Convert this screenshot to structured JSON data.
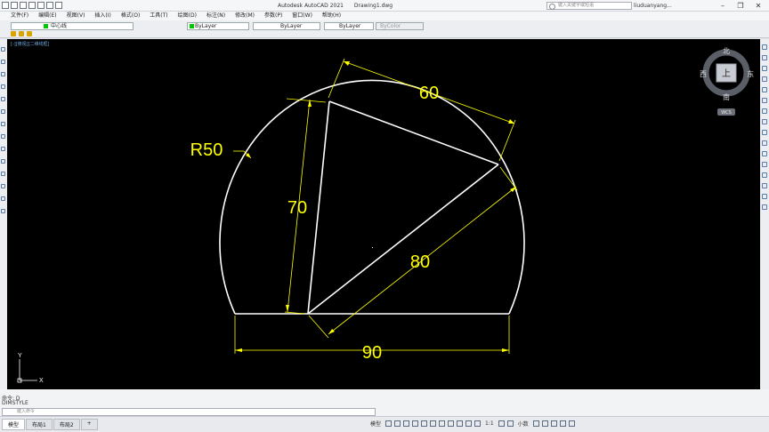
{
  "app": {
    "title": "Autodesk AutoCAD 2021",
    "file": "Drawing1.dwg",
    "search_placeholder": "键入关键字或短语",
    "user": "liuduanyang...",
    "minimize": "–",
    "restore": "❐",
    "close": "✕"
  },
  "menu": [
    "文件(F)",
    "编辑(E)",
    "视图(V)",
    "插入(I)",
    "格式(O)",
    "工具(T)",
    "绘图(D)",
    "标注(N)",
    "修改(M)",
    "参数(P)",
    "窗口(W)",
    "帮助(H)"
  ],
  "toolbar": {
    "layer": "中心线",
    "color": "ByLayer",
    "linetype": "ByLayer",
    "lineweight": "ByLayer",
    "plotstyle": "ByColor"
  },
  "viewport_label": "[-][俯视][二维线框]",
  "viewcube": {
    "north": "北",
    "south": "南",
    "east": "东",
    "west": "西",
    "face": "上",
    "wcs": "WCS"
  },
  "drawing": {
    "dim_60": "60",
    "dim_70": "70",
    "dim_80": "80",
    "dim_90": "90",
    "radius": "R50",
    "ucs_x": "X",
    "ucs_y": "Y",
    "line_color": "#ffffff",
    "dim_color": "#ffff00"
  },
  "command": {
    "history_1": "命令: D",
    "history_2": "DIMSTYLE",
    "prompt": "键入命令"
  },
  "status": {
    "tabs": [
      "模型",
      "布局1",
      "布局2"
    ],
    "add_tab": "+",
    "model": "模型",
    "scale": "1:1",
    "units": "小数"
  }
}
